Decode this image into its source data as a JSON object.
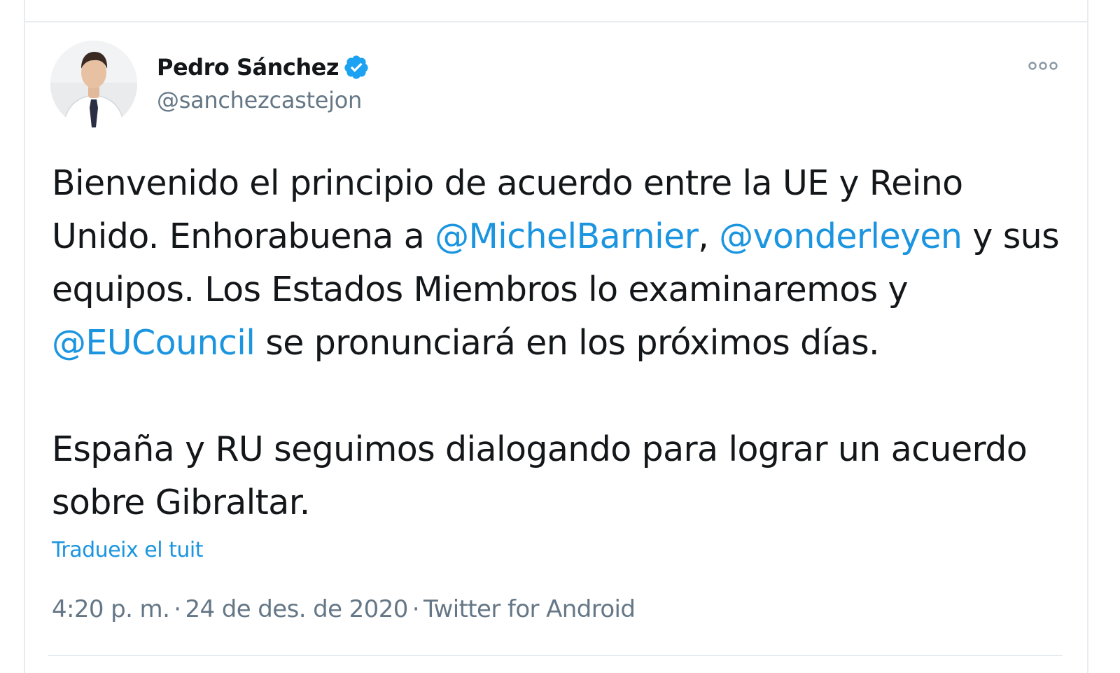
{
  "tweet": {
    "author": {
      "display_name": "Pedro Sánchez",
      "handle": "@sanchezcastejon",
      "verified": true
    },
    "more_icon": "more-dots-icon",
    "body": {
      "p1": {
        "t1": "Bienvenido el principio de acuerdo entre la UE y Reino Unido. Enhorabuena a ",
        "m1": "@MichelBarnier",
        "t2": ", ",
        "m2": "@vonderleyen",
        "t3": " y sus equipos. Los Estados Miembros lo examinaremos y ",
        "m3": "@EUCouncil",
        "t4": " se pronunciará en los próximos días."
      },
      "p2": "España y RU seguimos dialogando para lograr un acuerdo sobre Gibraltar."
    },
    "translate_label": "Tradueix el tuit",
    "meta": {
      "time": "4:20 p. m.",
      "separator": "·",
      "date": "24 de des. de 2020",
      "source": "Twitter for Android"
    }
  },
  "colors": {
    "text": "#14171a",
    "secondary": "#657786",
    "link": "#1b95e0",
    "verified": "#1da1f2",
    "border": "#e6ecf0"
  }
}
